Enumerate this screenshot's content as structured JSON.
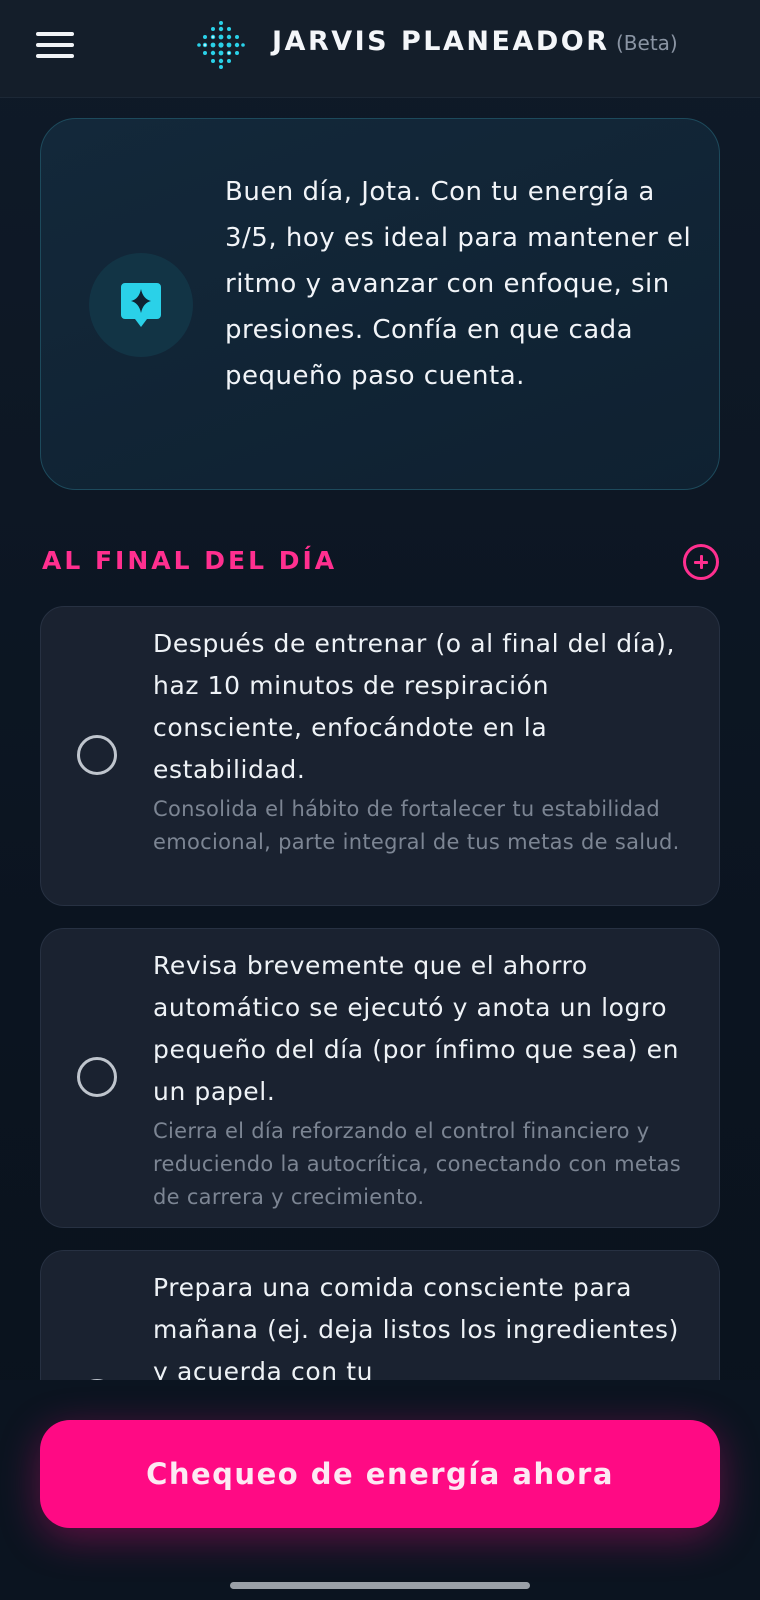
{
  "header": {
    "title": "JARVIS PLANEADOR",
    "beta_label": "(Beta)"
  },
  "greeting": {
    "message": "Buen día, Jota. Con tu energía a 3/5, hoy es ideal para mantener el ritmo y avanzar con enfoque, sin presiones. Confía en que cada pequeño paso cuenta.",
    "icon": "sparkle-chat-icon"
  },
  "section": {
    "title": "AL FINAL DEL DÍA"
  },
  "tasks": [
    {
      "title": "Después de entrenar (o al final del día), haz 10 minutos de respiración consciente, enfocándote en la estabilidad.",
      "subtitle": "Consolida el hábito de fortalecer tu estabilidad emocional, parte integral de tus metas de salud.",
      "checked": false
    },
    {
      "title": "Revisa brevemente que el ahorro automático se ejecutó y anota un logro pequeño del día (por ínfimo que sea) en un papel.",
      "subtitle": "Cierra el día reforzando el control financiero y reduciendo la autocrítica, conectando con metas de carrera y crecimiento.",
      "checked": false
    },
    {
      "title": "Prepara una comida consciente para mañana (ej. deja listos los ingredientes) y acuerda con tu",
      "subtitle": "",
      "checked": false
    }
  ],
  "cta": {
    "label": "Chequeo de energía ahora"
  },
  "colors": {
    "accent_pink": "#ff0a84",
    "section_pink": "#ff2f8f",
    "teal": "#2ad1e8",
    "background": "#0c1522"
  }
}
